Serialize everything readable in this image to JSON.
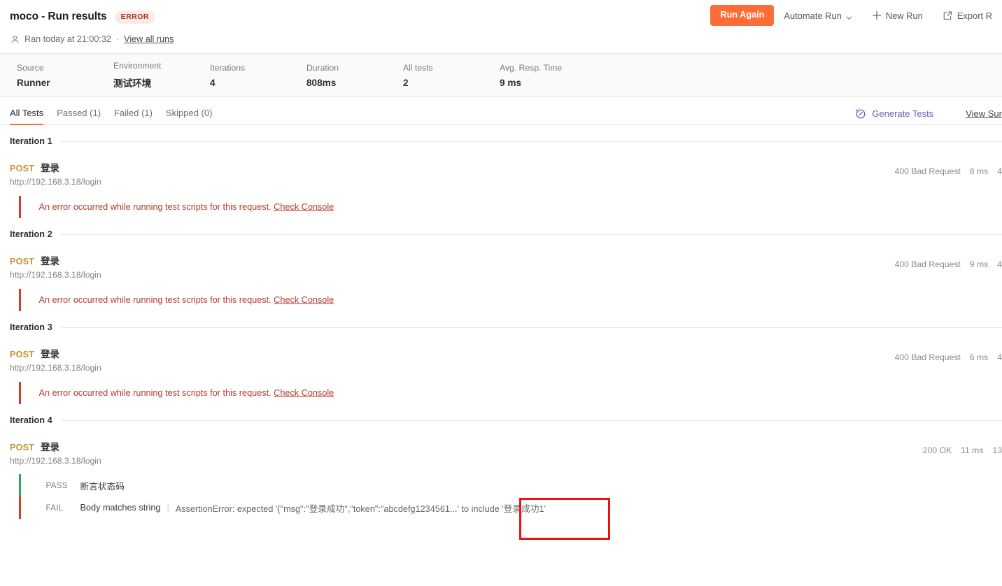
{
  "header": {
    "title": "moco - Run results",
    "status_badge": "ERROR",
    "person_icon": "person-icon",
    "ran_text": "Ran today at 21:00:32",
    "separator": "·",
    "view_all_runs": "View all runs",
    "actions": {
      "run_again": "Run Again",
      "automate_run": "Automate Run",
      "chevron_icon": "chevron-down-icon",
      "new_run": "New Run",
      "plus_icon": "plus-icon",
      "export_results": "Export R",
      "export_icon": "export-icon"
    }
  },
  "stats": [
    {
      "label": "Source",
      "value": "Runner"
    },
    {
      "label": "Environment",
      "value": "测试环境"
    },
    {
      "label": "Iterations",
      "value": "4"
    },
    {
      "label": "Duration",
      "value": "808ms"
    },
    {
      "label": "All tests",
      "value": "2"
    },
    {
      "label": "Avg. Resp. Time",
      "value": "9 ms"
    }
  ],
  "tabs": [
    {
      "label": "All Tests",
      "active": true
    },
    {
      "label": "Passed (1)",
      "active": false
    },
    {
      "label": "Failed (1)",
      "active": false
    },
    {
      "label": "Skipped (0)",
      "active": false
    }
  ],
  "tabs_right": {
    "generate_tests": "Generate Tests",
    "ai_icon": "ai-sparkle-icon",
    "view_summary": "View Sur"
  },
  "iterations": [
    {
      "label": "Iteration 1",
      "request": {
        "method": "POST",
        "name": "登录",
        "url": "http://192.168.3.18/login",
        "status": "400 Bad Request",
        "time": "8 ms",
        "size": "4"
      },
      "error": {
        "text": "An error occurred while running test scripts for this request.",
        "link": "Check Console"
      }
    },
    {
      "label": "Iteration 2",
      "request": {
        "method": "POST",
        "name": "登录",
        "url": "http://192.168.3.18/login",
        "status": "400 Bad Request",
        "time": "9 ms",
        "size": "4"
      },
      "error": {
        "text": "An error occurred while running test scripts for this request.",
        "link": "Check Console"
      }
    },
    {
      "label": "Iteration 3",
      "request": {
        "method": "POST",
        "name": "登录",
        "url": "http://192.168.3.18/login",
        "status": "400 Bad Request",
        "time": "6 ms",
        "size": "4"
      },
      "error": {
        "text": "An error occurred while running test scripts for this request.",
        "link": "Check Console"
      }
    },
    {
      "label": "Iteration 4",
      "request": {
        "method": "POST",
        "name": "登录",
        "url": "http://192.168.3.18/login",
        "status": "200 OK",
        "time": "11 ms",
        "size": "13"
      },
      "assertions": [
        {
          "status": "PASS",
          "name": "断言状态码",
          "detail": ""
        },
        {
          "status": "FAIL",
          "name": "Body matches string",
          "detail": "AssertionError: expected '{\"msg\":\"登录成功\",\"token\":\"abcdefg1234561...' to include '登录成功1'"
        }
      ]
    }
  ],
  "annotation": {
    "color": "#ee1111"
  }
}
